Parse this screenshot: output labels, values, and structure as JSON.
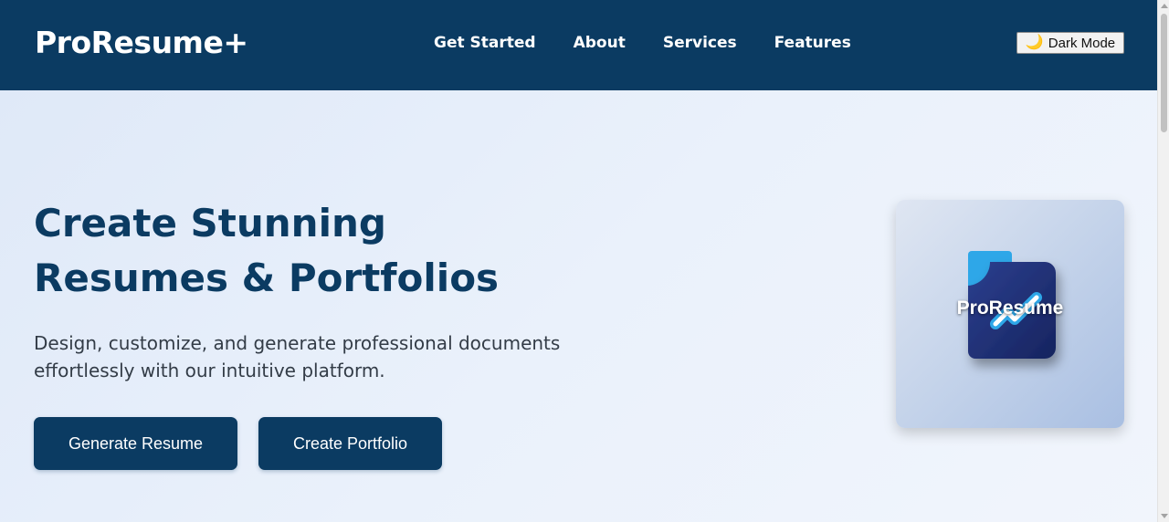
{
  "header": {
    "logo": "ProResume+",
    "nav": [
      "Get Started",
      "About",
      "Services",
      "Features"
    ],
    "dark_mode_label": "Dark Mode",
    "dark_mode_icon": "moon-icon"
  },
  "hero": {
    "title": "Create Stunning Resumes & Portfolios",
    "subtitle": "Design, customize, and generate professional documents effortlessly with our intuitive platform.",
    "buttons": {
      "generate_label": "Generate Resume",
      "portfolio_label": "Create Portfolio"
    },
    "image_logo_text": "ProResume"
  },
  "colors": {
    "navbar": "#0b3b62",
    "accent": "#0b3b62",
    "hero_background": "#eaf1fb"
  }
}
